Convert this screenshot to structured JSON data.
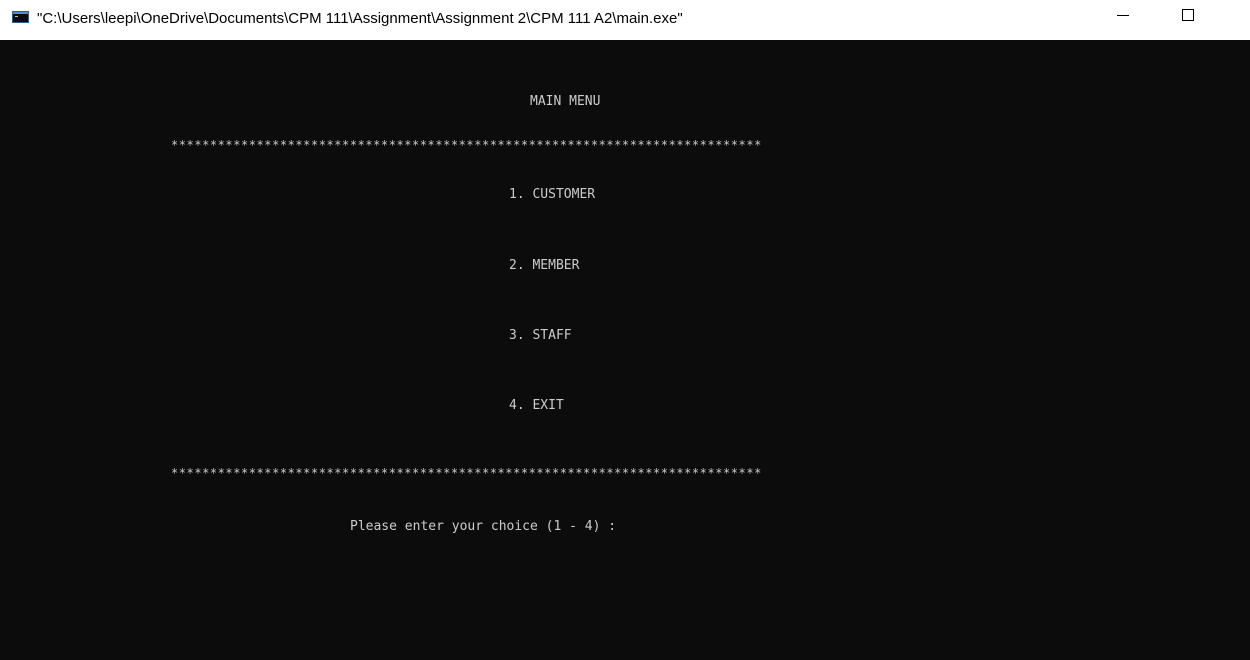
{
  "window": {
    "title": "\"C:\\Users\\leepi\\OneDrive\\Documents\\CPM 111\\Assignment\\Assignment 2\\CPM 111 A2\\main.exe\"",
    "app_icon": "console-window-icon",
    "minimize_icon": "minimize-icon",
    "maximize_icon": "maximize-icon"
  },
  "console": {
    "background_color": "#0c0c0c",
    "text_color": "#cccccc",
    "menu_title": "MAIN MENU",
    "divider": "****************************************************************************",
    "options": [
      "1. CUSTOMER",
      "2. MEMBER",
      "3. STAFF",
      "4. EXIT"
    ],
    "prompt": "Please enter your choice (1 - 4) :"
  }
}
